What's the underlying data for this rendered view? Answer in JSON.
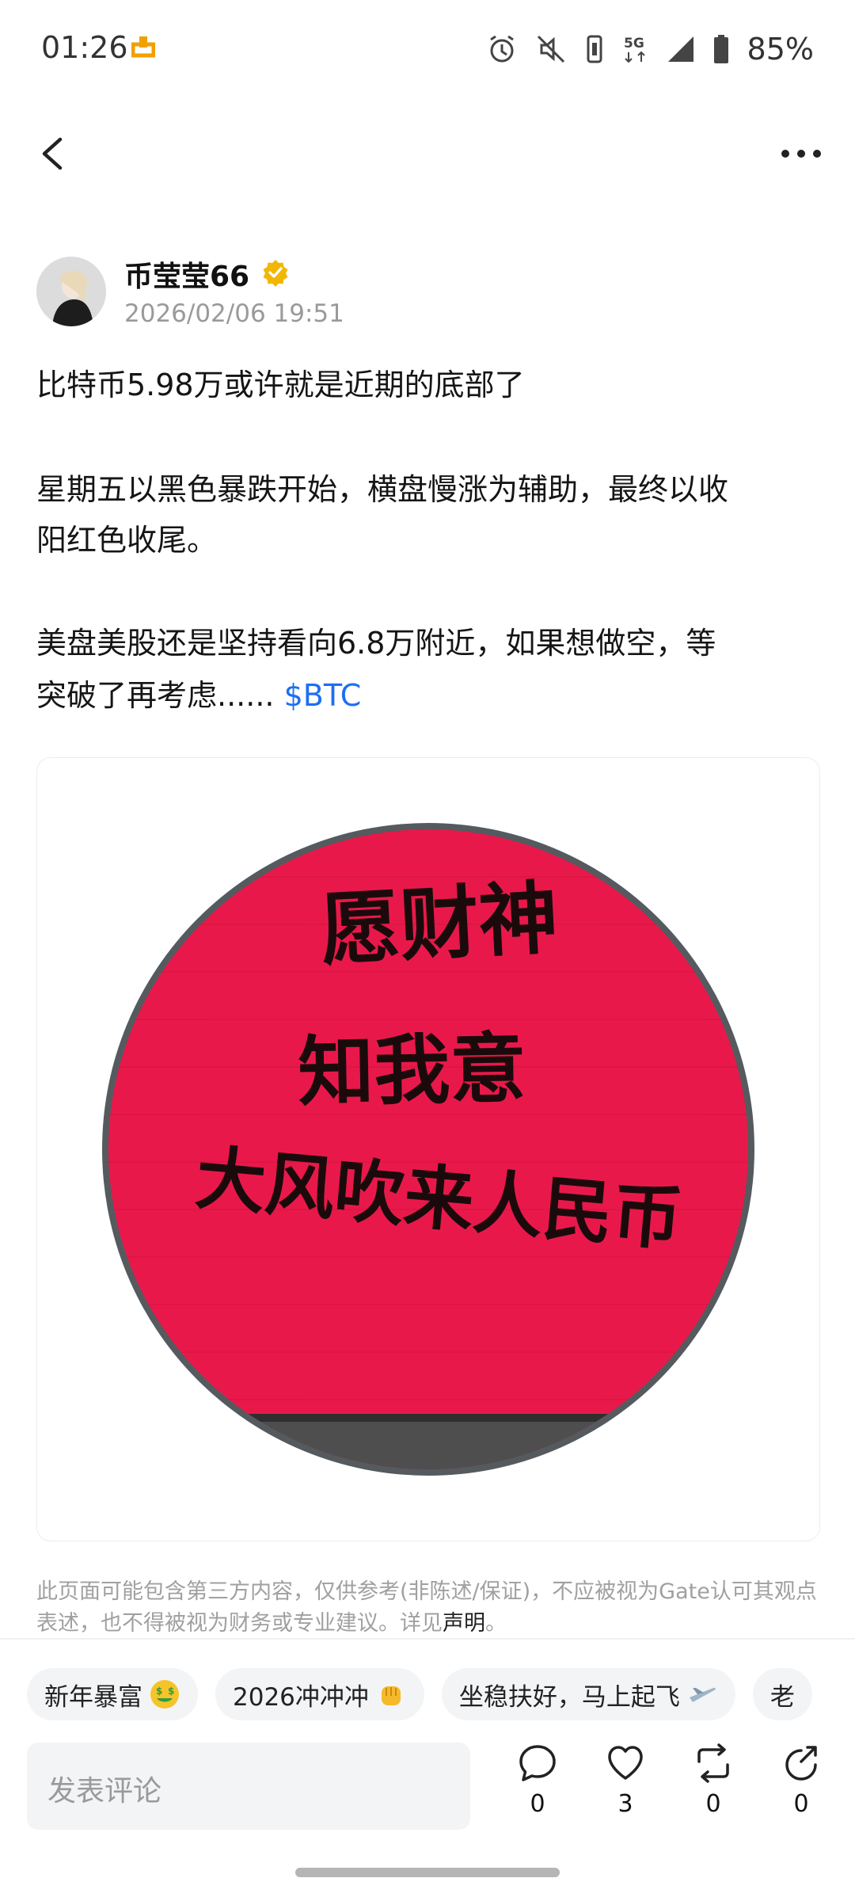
{
  "status_bar": {
    "time": "01:26",
    "network": "5G",
    "battery": "85%"
  },
  "post": {
    "author": "币莹莹66",
    "timestamp": "2026/02/06 19:51",
    "lines": [
      "比特币5.98万或许就是近期的底部了",
      "星期五以黑色暴跌开始，横盘慢涨为辅助，最终以收",
      "阳红色收尾。",
      "美盘美股还是坚持看向6.8万附近，如果想做空，等",
      "突破了再考虑......"
    ],
    "ticker_tag": "$BTC",
    "image": {
      "sign_text": [
        "愿财神",
        "知我意",
        "大风吹来人民币"
      ],
      "sign_color": "#e8194a"
    }
  },
  "disclaimer": {
    "text": "此页面可能包含第三方内容，仅供参考(非陈述/保证)，不应被视为Gate认可其观点表述，也不得被视为财务或专业建议。详见",
    "link": "声明",
    "end": "。"
  },
  "topics": [
    {
      "label": "新年暴富",
      "emoji": "money-face"
    },
    {
      "label": "2026冲冲冲",
      "emoji": "fist"
    },
    {
      "label": "坐稳扶好，马上起飞",
      "emoji": "airplane"
    },
    {
      "label": "老",
      "emoji": ""
    }
  ],
  "comment_bar": {
    "placeholder": "发表评论",
    "comments": "0",
    "likes": "3",
    "reposts": "0",
    "shares": "0"
  }
}
